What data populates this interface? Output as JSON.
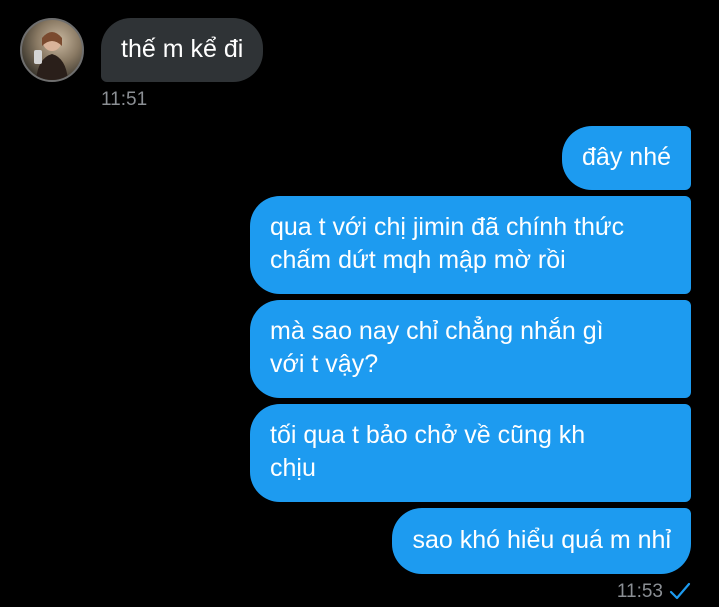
{
  "incoming": {
    "message": "thế m kể đi",
    "time": "11:51"
  },
  "outgoing": {
    "messages": [
      "đây nhé",
      "qua t với chị jimin đã chính thức",
      "chấm dứt mqh mập mờ rồi",
      "mà sao nay chỉ chẳng nhắn gì",
      "với t vậy?",
      "tối qua t bảo chở về cũng kh",
      "chịu",
      "sao khó hiểu quá m nhỉ"
    ],
    "time": "11:53",
    "status_icon": "check-icon",
    "accent_color": "#1d9bf0"
  },
  "colors": {
    "background": "#000000",
    "incoming_bubble": "#2f3336",
    "timestamp": "#8b8f94"
  }
}
